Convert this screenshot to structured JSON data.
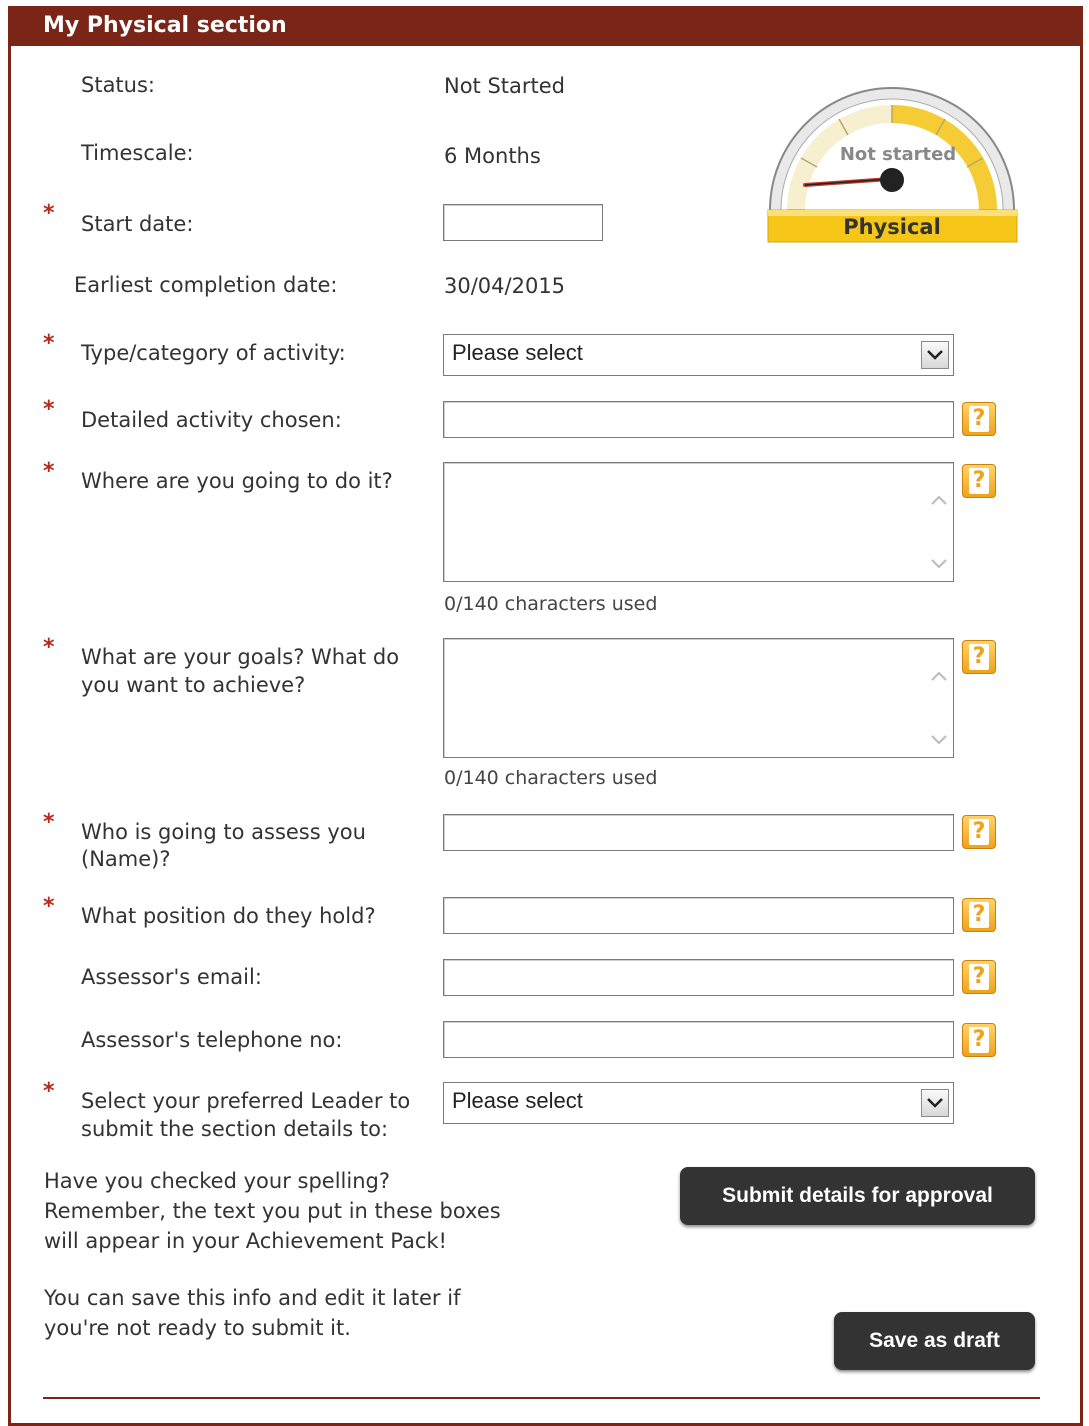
{
  "header": {
    "title": "My Physical section"
  },
  "fields": {
    "status": {
      "label": "Status:",
      "value": "Not Started"
    },
    "timescale": {
      "label": "Timescale:",
      "value": "6 Months"
    },
    "start_date": {
      "label": "Start date:",
      "value": ""
    },
    "earliest": {
      "label": "Earliest completion date:",
      "value": "30/04/2015"
    },
    "type": {
      "label": "Type/category of activity:",
      "value": "Please select"
    },
    "detailed": {
      "label": "Detailed activity chosen:",
      "value": ""
    },
    "where": {
      "label": "Where are you going to do it?",
      "value": "",
      "counter": "0/140 characters used"
    },
    "goals": {
      "label_line1": "What are your goals? What do",
      "label_line2": "you want to achieve?",
      "value": "",
      "counter": "0/140 characters used"
    },
    "assessor_name": {
      "label_line1": "Who is going to assess you",
      "label_line2": "(Name)?",
      "value": ""
    },
    "position": {
      "label": "What position do they hold?",
      "value": ""
    },
    "email": {
      "label": "Assessor's email:",
      "value": ""
    },
    "phone": {
      "label": "Assessor's telephone no:",
      "value": ""
    },
    "leader": {
      "label_line1": "Select your preferred Leader to",
      "label_line2": "submit the section details to:",
      "value": "Please select"
    }
  },
  "required_marker": "*",
  "help_icon": "?",
  "gauge": {
    "status_text": "Not started",
    "section_label": "Physical",
    "progress": 0,
    "colors": {
      "fill": "#f5c518",
      "needle": "#c0392b"
    }
  },
  "notes": {
    "spelling_line1": "Have you checked your spelling?",
    "spelling_line2": "Remember, the text you put in these boxes",
    "spelling_line3": "will appear in your Achievement Pack!",
    "save_line1": "You can save this info and edit it later if",
    "save_line2": "you're not ready to submit it."
  },
  "buttons": {
    "submit": "Submit details for approval",
    "draft": "Save as draft"
  },
  "colors": {
    "brand": "#7a2518",
    "button": "#333333",
    "help": "#f0a21a",
    "required": "#b52a1c"
  }
}
